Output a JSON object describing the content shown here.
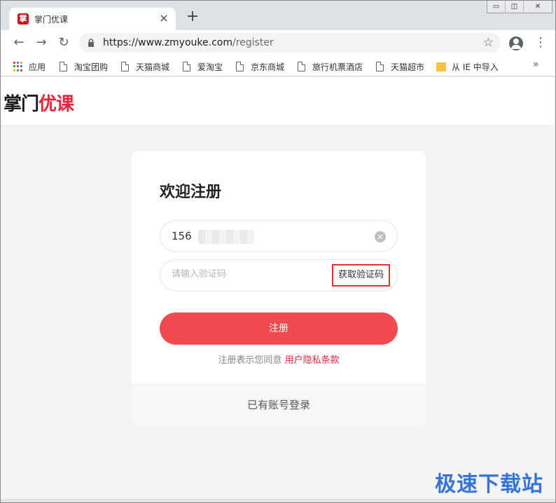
{
  "browser": {
    "tab_title": "掌门优课",
    "tab_favicon": "掌",
    "tab_close": "×",
    "new_tab": "+",
    "url_host": "https://www.zmyouke.com",
    "url_path": "/register",
    "bookmarks": {
      "apps": "应用",
      "items": [
        "淘宝团购",
        "天猫商城",
        "爱淘宝",
        "京东商城",
        "旅行机票酒店",
        "天猫超市"
      ],
      "folder": "从 IE 中导入",
      "more": "»"
    },
    "icons": {
      "back": "←",
      "forward": "→",
      "reload": "↻",
      "star": "☆",
      "menu": "⋮",
      "minimize": "▭",
      "maximize": "◫",
      "close": "✕"
    }
  },
  "site": {
    "logo_part1": "掌门",
    "logo_part2": "优课",
    "logo_colors": {
      "part1": "#1a1a1a",
      "part2": "#e2273d"
    }
  },
  "register": {
    "title": "欢迎注册",
    "phone_value": "156",
    "code_placeholder": "请输入验证码",
    "get_code_label": "获取验证码",
    "submit_label": "注册",
    "agree_text": "注册表示您同意 ",
    "agree_link": "用户隐私条款",
    "login_link": "已有账号登录",
    "accent_color": "#ef4b51"
  },
  "watermark": "极速下载站"
}
